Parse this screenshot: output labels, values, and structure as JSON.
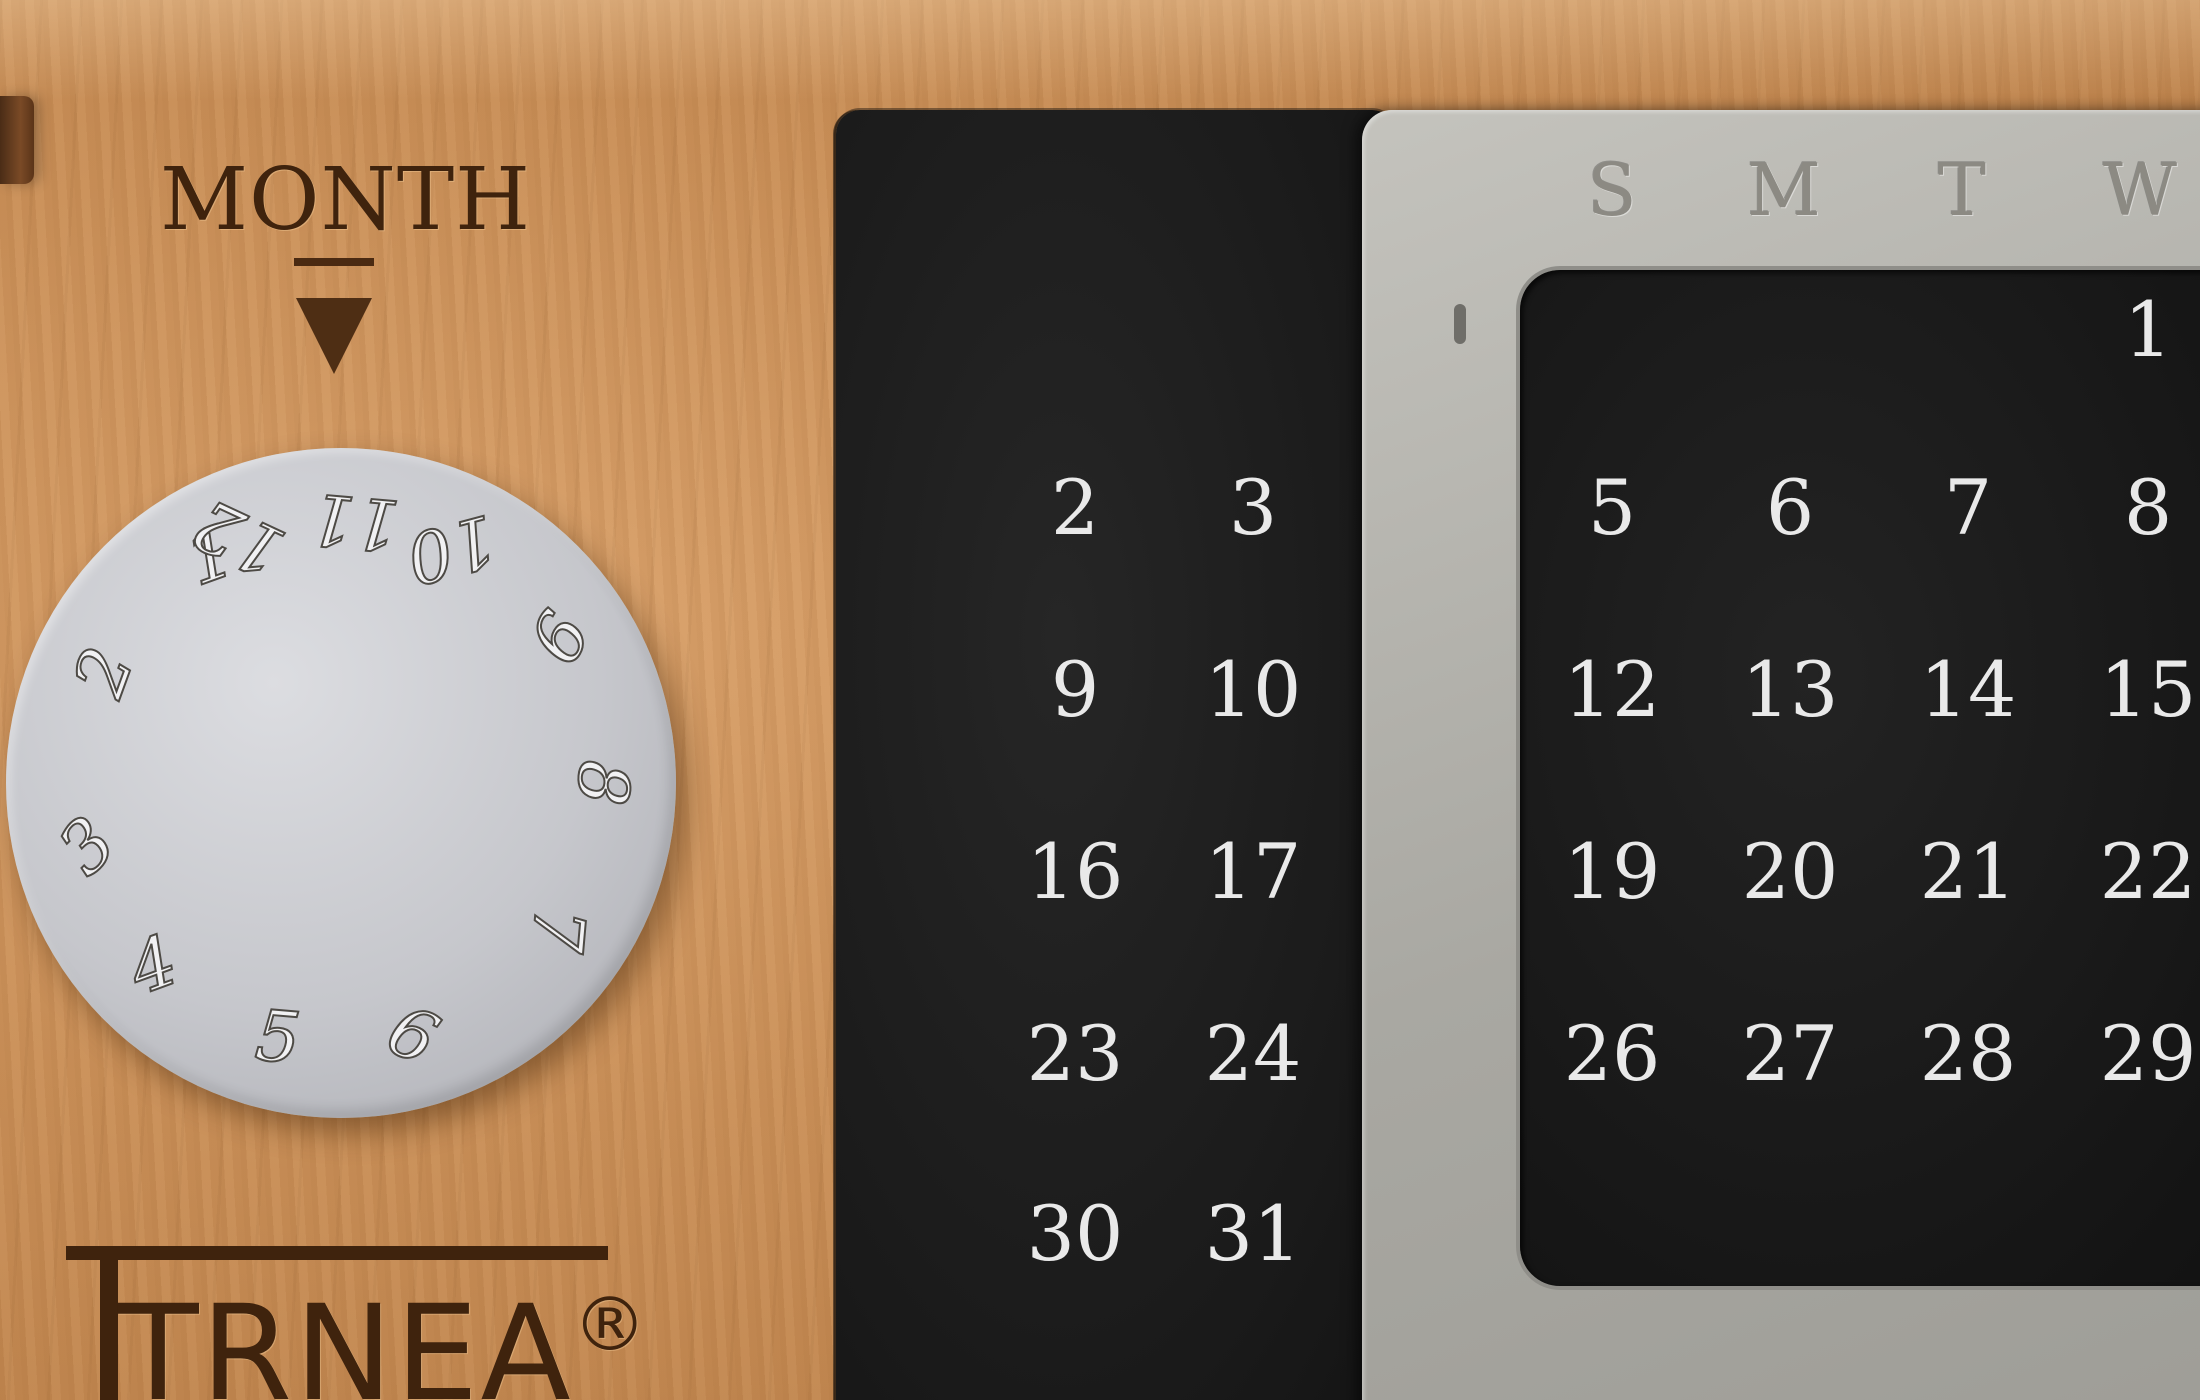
{
  "month_label": "MONTH",
  "brand": {
    "name": "TRNEA",
    "reg": "®"
  },
  "dial_numbers": [
    "1",
    "2",
    "3",
    "4",
    "5",
    "6",
    "7",
    "8",
    "9",
    "10",
    "11",
    "12"
  ],
  "weekday_labels": [
    "S",
    "M",
    "T",
    "W"
  ],
  "left_dates": [
    "2",
    "3",
    "9",
    "10",
    "16",
    "17",
    "23",
    "24",
    "30",
    "31"
  ],
  "right_dates": [
    "1",
    "5",
    "6",
    "7",
    "8",
    "12",
    "13",
    "14",
    "15",
    "19",
    "20",
    "21",
    "22",
    "26",
    "27",
    "28",
    "29"
  ]
}
